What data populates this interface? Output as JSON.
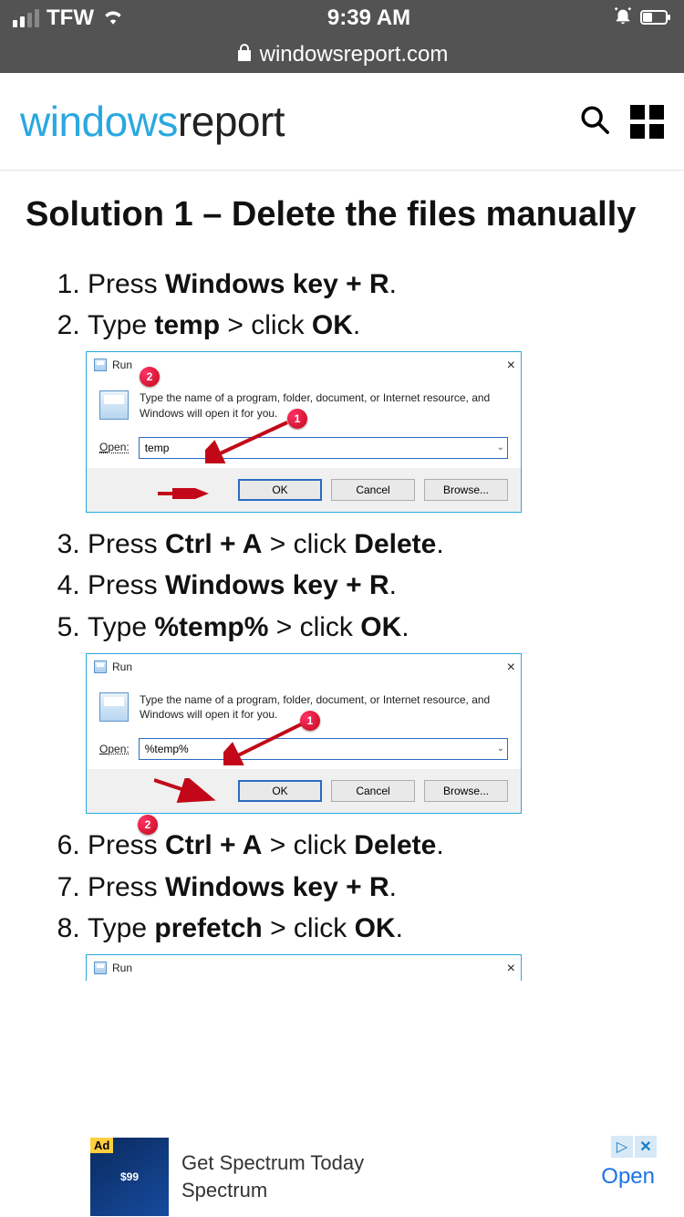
{
  "status": {
    "carrier": "TFW",
    "time": "9:39 AM"
  },
  "nav": {
    "host": "windowsreport.com"
  },
  "logo": {
    "part1": "windows",
    "part2": "report"
  },
  "article": {
    "heading": "Solution 1 – Delete the files manually",
    "steps": [
      {
        "pre": "Press ",
        "bold": "Windows key + R",
        "post": "."
      },
      {
        "pre": "Type ",
        "bold": "temp",
        "mid": " > click ",
        "bold2": "OK",
        "post": "."
      },
      {
        "pre": "Press ",
        "bold": "Ctrl + A",
        "mid": " > click ",
        "bold2": "Delete",
        "post": "."
      },
      {
        "pre": "Press ",
        "bold": "Windows key + R",
        "post": "."
      },
      {
        "pre": "Type ",
        "bold": "%temp%",
        "mid": " > click ",
        "bold2": "OK",
        "post": "."
      },
      {
        "pre": "Press ",
        "bold": "Ctrl + A",
        "mid": " > click ",
        "bold2": "Delete",
        "post": "."
      },
      {
        "pre": "Press ",
        "bold": "Windows key + R",
        "post": "."
      },
      {
        "pre": "Type ",
        "bold": "prefetch",
        "mid": " > click ",
        "bold2": "OK",
        "post": "."
      }
    ]
  },
  "runDialog": {
    "title": "Run",
    "desc": "Type the name of a program, folder, document, or Internet resource, and Windows will open it for you.",
    "openLabel": "Open:",
    "ok": "OK",
    "cancel": "Cancel",
    "browse": "Browse...",
    "marker1": "1",
    "marker2": "2",
    "value1": "temp",
    "value2": "%temp%"
  },
  "ad": {
    "badge": "Ad",
    "price": "$99",
    "line1": "Get Spectrum Today",
    "line2": "Spectrum",
    "cta": "Open"
  }
}
